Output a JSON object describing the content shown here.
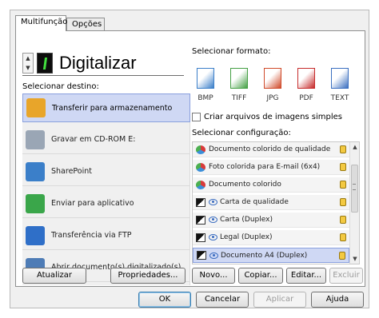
{
  "tabs": [
    "Multifunção",
    "Opções"
  ],
  "mode": {
    "title": "Digitalizar",
    "spinner_up": "▲",
    "spinner_down": "▼"
  },
  "labels": {
    "select_destination": "Selecionar destino:",
    "select_format": "Selecionar formato:",
    "simple_images": "Criar arquivos de imagens simples",
    "select_configuration": "Selecionar configuração:"
  },
  "destinations": [
    {
      "label": "Transferir para armazenamento",
      "icon": "storage-folder-icon",
      "color": "#e8a52a",
      "selected": true
    },
    {
      "label": "Gravar em CD-ROM  E:",
      "icon": "cd-rom-icon",
      "color": "#9aa6b5",
      "selected": false
    },
    {
      "label": "SharePoint",
      "icon": "sharepoint-icon",
      "color": "#3b7fc9",
      "selected": false
    },
    {
      "label": "Enviar para aplicativo",
      "icon": "send-to-app-icon",
      "color": "#3aa64a",
      "selected": false
    },
    {
      "label": "Transferência via FTP",
      "icon": "ftp-icon",
      "color": "#2f6fc8",
      "selected": false
    },
    {
      "label": "Abrir documento(s) digitalizado(s)",
      "icon": "open-document-icon",
      "color": "#4e7cb6",
      "selected": false
    }
  ],
  "formats": [
    {
      "label": "BMP",
      "icon": "bmp-format-icon",
      "color": "#3b7fc9"
    },
    {
      "label": "TIFF",
      "icon": "tiff-format-icon",
      "color": "#45a045"
    },
    {
      "label": "JPG",
      "icon": "jpg-format-icon",
      "color": "#d04a2a"
    },
    {
      "label": "PDF",
      "icon": "pdf-format-icon",
      "color": "#c62b2b"
    },
    {
      "label": "TEXT",
      "icon": "text-format-icon",
      "color": "#3b6fc0"
    }
  ],
  "configurations": [
    {
      "label": "Documento colorido de qualidade",
      "kind": "color",
      "selected": false
    },
    {
      "label": "Foto colorida para E-mail (6x4)",
      "kind": "color",
      "selected": false
    },
    {
      "label": "Documento colorido",
      "kind": "color",
      "selected": false
    },
    {
      "label": "Carta de qualidade",
      "kind": "bw",
      "selected": false
    },
    {
      "label": "Carta (Duplex)",
      "kind": "bw",
      "selected": false
    },
    {
      "label": "Legal (Duplex)",
      "kind": "bw",
      "selected": false
    },
    {
      "label": "Documento A4 (Duplex)",
      "kind": "bw",
      "selected": true
    }
  ],
  "buttons": {
    "refresh": "Atualizar",
    "properties": "Propriedades...",
    "new": "Novo...",
    "copy": "Copiar...",
    "edit": "Editar...",
    "delete": "Excluir",
    "ok": "OK",
    "cancel": "Cancelar",
    "apply": "Aplicar",
    "help": "Ajuda"
  },
  "colors": {
    "selection": "#cfd8f4",
    "selection_border": "#8aa0dd",
    "lock": "#f3c941"
  }
}
